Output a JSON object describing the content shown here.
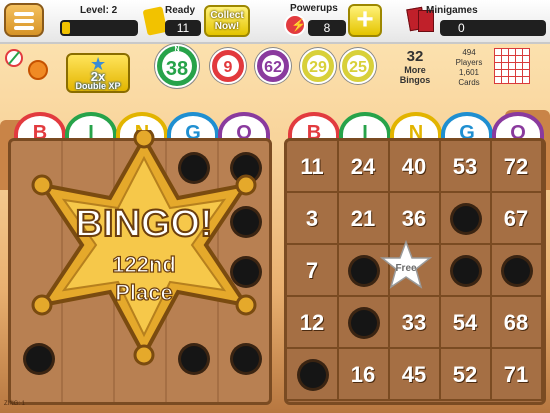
{
  "header": {
    "level_label": "Level: 2",
    "ready_label": "Ready",
    "ready_value": "11",
    "collect_label": "Collect Now!",
    "powerups_label": "Powerups",
    "powerups_value": "8",
    "plus_label": "+",
    "minigames_label": "Minigames",
    "minigames_value": "0"
  },
  "xp_badge": {
    "multiplier": "2x",
    "label": "Double XP"
  },
  "called_balls": [
    {
      "letter": "N",
      "number": "38",
      "color": "#27a34a",
      "latest": true
    },
    {
      "letter": "",
      "number": "9",
      "color": "#e2393d"
    },
    {
      "letter": "",
      "number": "62",
      "color": "#8a3a9e"
    },
    {
      "letter": "",
      "number": "29",
      "color": "#d8d03a"
    },
    {
      "letter": "",
      "number": "25",
      "color": "#d8d03a"
    }
  ],
  "more_bingos": {
    "count": "32",
    "label": "More Bingos"
  },
  "stats": {
    "players_count": "494",
    "players_label": "Players",
    "cards_count": "1,601",
    "cards_label": "Cards"
  },
  "column_headers": [
    "B",
    "I",
    "N",
    "G",
    "O"
  ],
  "column_colors": [
    "#e23b3f",
    "#27a34a",
    "#e2b400",
    "#1f8fd1",
    "#8a3a9e"
  ],
  "bingo_badge": {
    "title": "BINGO!",
    "place": "122nd",
    "place_label": "Place"
  },
  "right_card": {
    "cells": [
      [
        "11",
        "24",
        "40",
        "53",
        "72"
      ],
      [
        "3",
        "21",
        "36",
        "",
        "67"
      ],
      [
        "7",
        "",
        "Free",
        "",
        ""
      ],
      [
        "12",
        "",
        "33",
        "54",
        "68"
      ],
      [
        "",
        "16",
        "45",
        "52",
        "71"
      ]
    ],
    "free_label": "Free"
  },
  "footer_tag": "ZING: 1",
  "colors": {
    "gold": "#f2c200",
    "wood": "#a56f44",
    "dark_hud": "#1f1f1f"
  }
}
